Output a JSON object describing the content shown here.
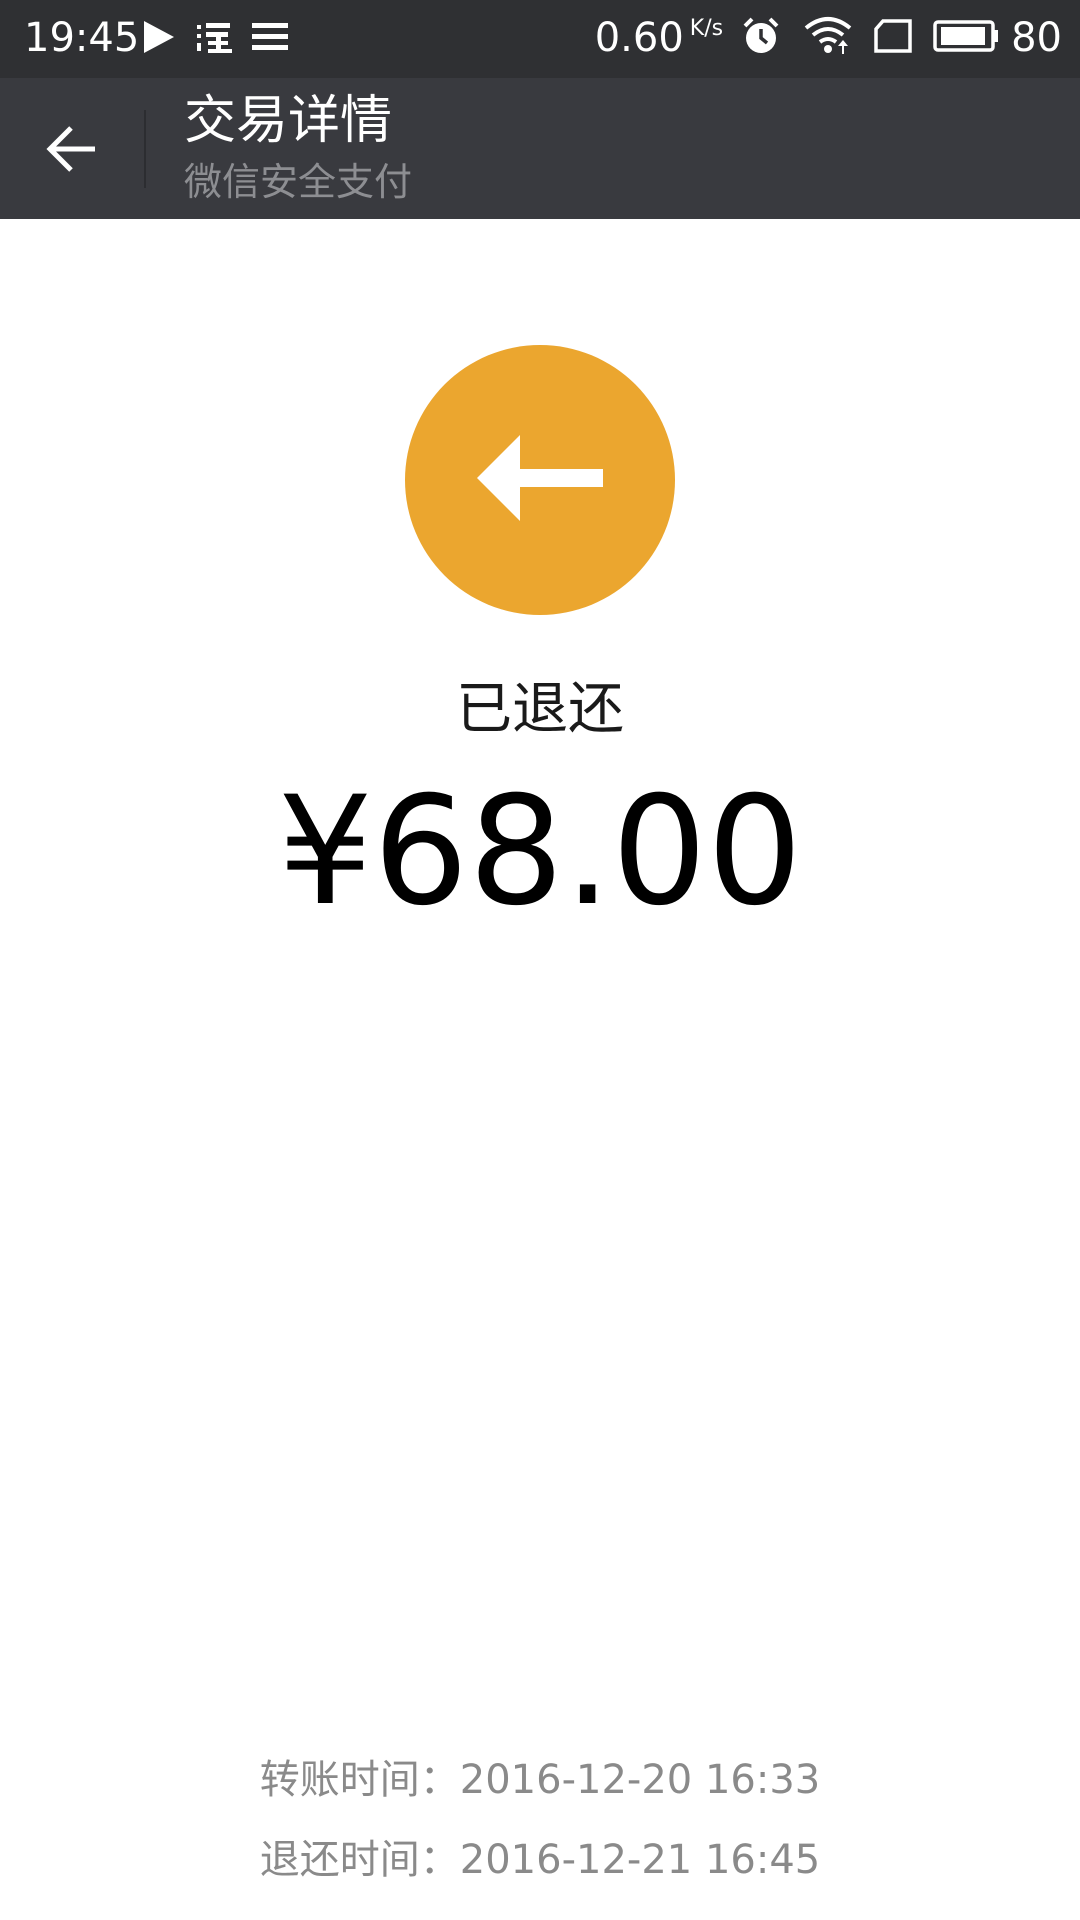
{
  "status_bar": {
    "time": "19:45",
    "speed": "0.60",
    "speed_unit": "K/s",
    "battery": "80",
    "icons": [
      "play-icon",
      "taobao-icon",
      "menu-icon",
      "alarm-icon",
      "wifi-icon",
      "sim-icon",
      "battery-icon"
    ]
  },
  "header": {
    "title": "交易详情",
    "subtitle": "微信安全支付",
    "back_icon": "arrow-left-icon"
  },
  "transaction": {
    "status_icon": "arrow-left-icon",
    "status_color": "#EBA62F",
    "status": "已退还",
    "amount": "¥68.00"
  },
  "details": [
    {
      "label": "转账时间：",
      "value": "2016-12-20 16:33"
    },
    {
      "label": "退还时间：",
      "value": "2016-12-21 16:45"
    }
  ],
  "colors": {
    "status_bar_bg": "#2F3033",
    "header_bg": "#393A3F",
    "accent": "#EBA62F"
  }
}
